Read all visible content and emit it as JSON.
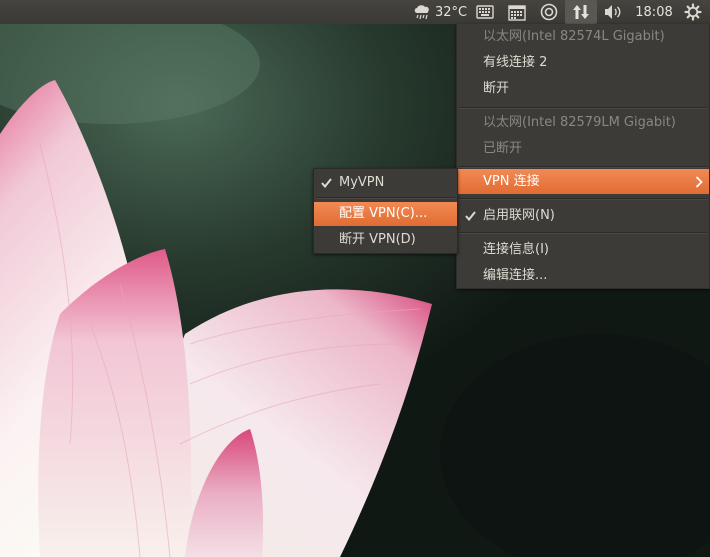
{
  "panel": {
    "weather_icon": "cloud-rain-icon",
    "temperature": "32°C",
    "keyboard_icon": "keyboard-icon",
    "calendar_icon": "calendar-icon",
    "chat_icon": "chat-status-icon",
    "network_icon": "network-transfer-icon",
    "volume_icon": "volume-icon",
    "clock": "18:08",
    "session_icon": "gear-icon"
  },
  "network_menu": {
    "items": [
      {
        "label": "以太网(Intel 82574L Gigabit)",
        "state": "disabled"
      },
      {
        "label": "有线连接 2",
        "state": "normal"
      },
      {
        "label": "断开",
        "state": "normal"
      },
      {
        "label": "以太网(Intel 82579LM Gigabit)",
        "state": "disabled"
      },
      {
        "label": "已断开",
        "state": "disabled"
      },
      {
        "label": "VPN 连接",
        "state": "highlighted",
        "submenu": true
      },
      {
        "label": "启用联网(N)",
        "state": "checked"
      },
      {
        "label": "连接信息(I)",
        "state": "normal"
      },
      {
        "label": "编辑连接...",
        "state": "normal"
      }
    ]
  },
  "vpn_menu": {
    "items": [
      {
        "label": "MyVPN",
        "state": "checked"
      },
      {
        "label": "配置 VPN(C)...",
        "state": "highlighted"
      },
      {
        "label": "断开 VPN(D)",
        "state": "normal"
      }
    ]
  },
  "colors": {
    "panel_bg": "#3c3b37",
    "menu_bg": "#3d3b37",
    "highlight": "#e9743a",
    "menu_text": "#dfdbd2",
    "disabled_text": "#8a8781"
  }
}
